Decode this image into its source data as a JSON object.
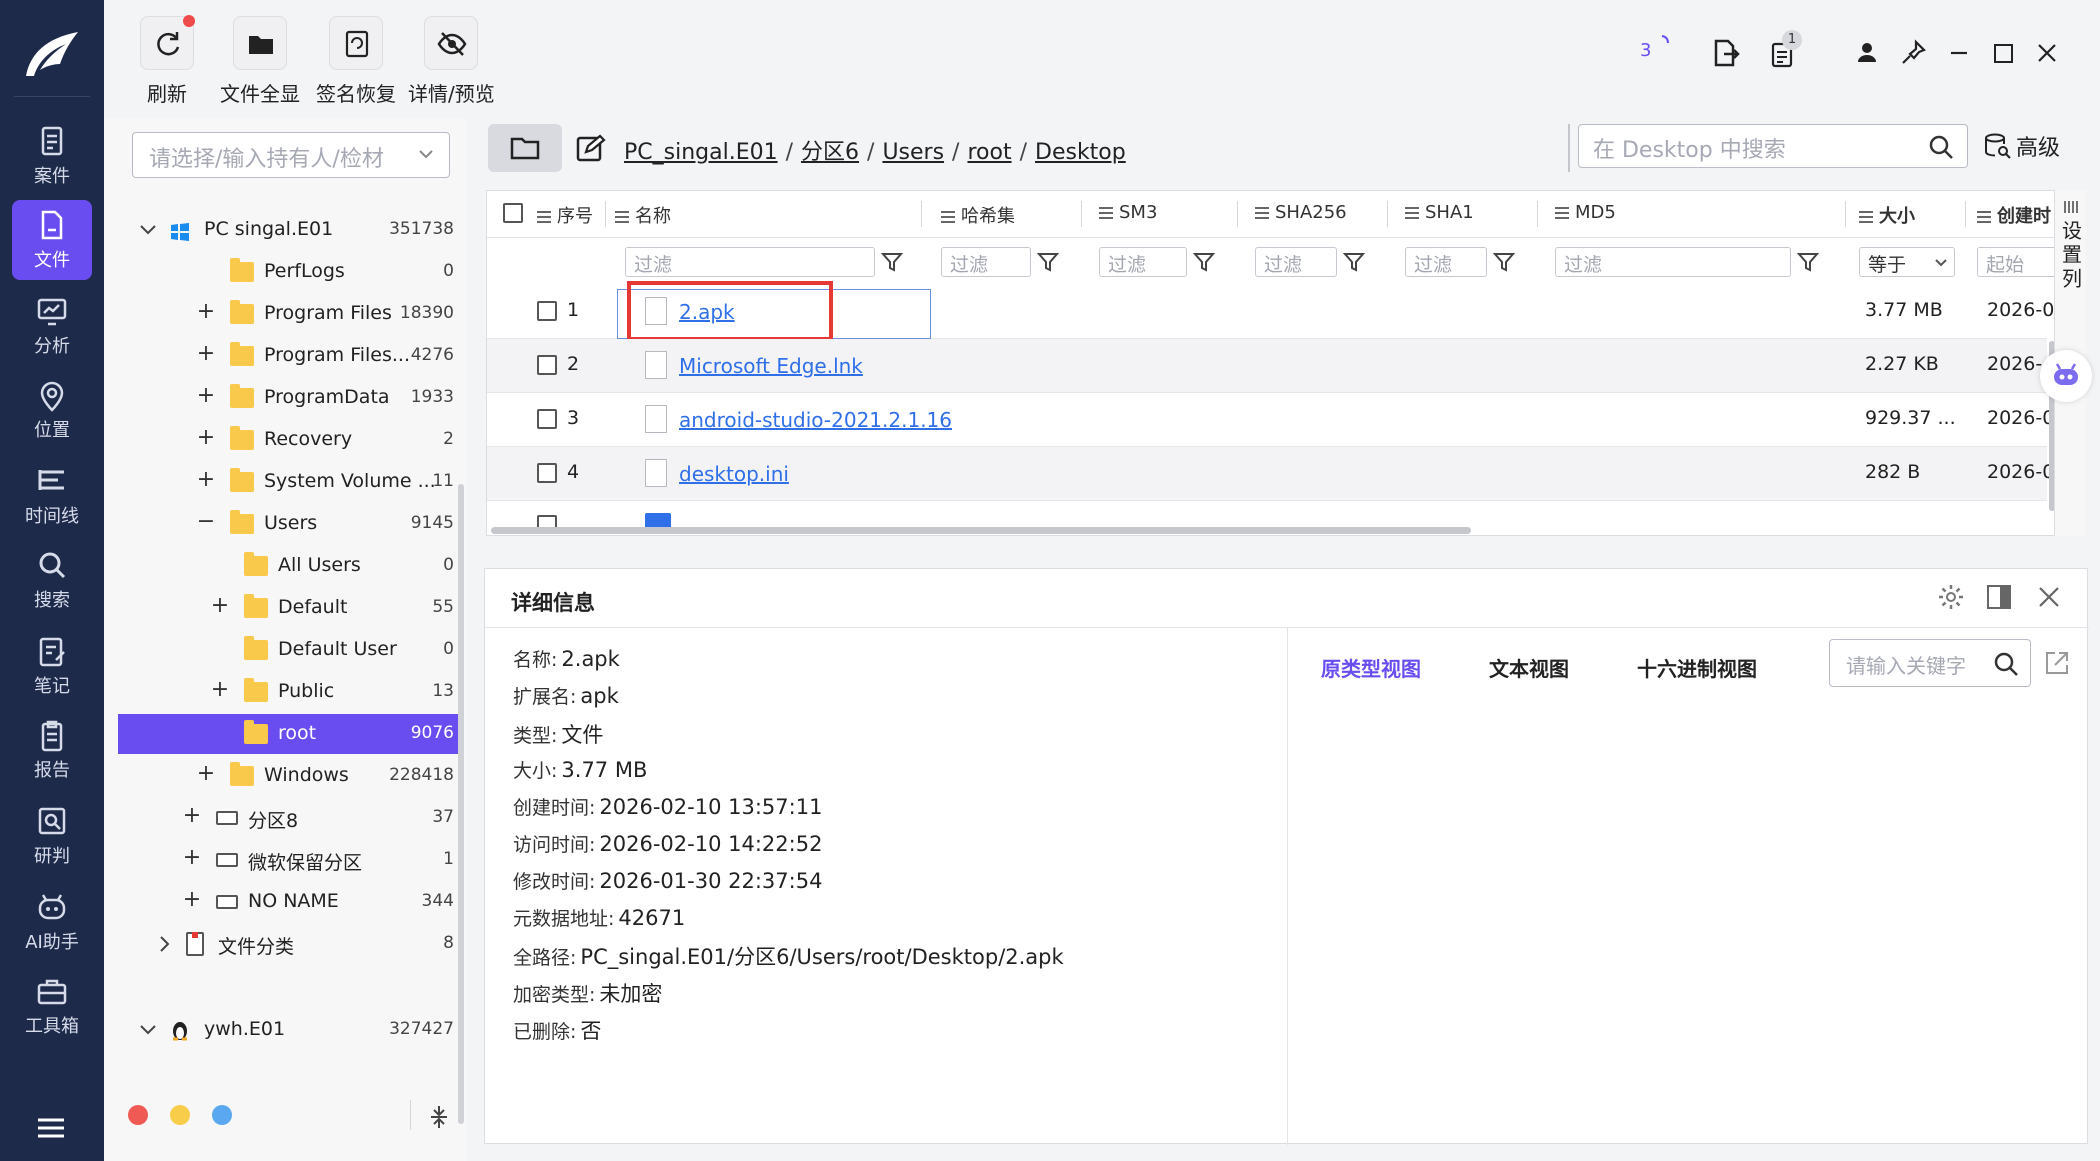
{
  "toolbar": {
    "refresh": "刷新",
    "show_all": "文件全显",
    "sig_restore": "签名恢复",
    "detail_preview": "详情/预览",
    "badge_count": "3",
    "tasks_badge": "1"
  },
  "rail": [
    {
      "label": "案件",
      "icon": "case-icon"
    },
    {
      "label": "文件",
      "icon": "file-icon"
    },
    {
      "label": "分析",
      "icon": "analysis-icon"
    },
    {
      "label": "位置",
      "icon": "location-icon"
    },
    {
      "label": "时间线",
      "icon": "timeline-icon"
    },
    {
      "label": "搜索",
      "icon": "search-icon"
    },
    {
      "label": "笔记",
      "icon": "note-icon"
    },
    {
      "label": "报告",
      "icon": "report-icon"
    },
    {
      "label": "研判",
      "icon": "judge-icon"
    },
    {
      "label": "AI助手",
      "icon": "robot-icon"
    },
    {
      "label": "工具箱",
      "icon": "toolbox-icon"
    }
  ],
  "tree": {
    "owner_placeholder": "请选择/输入持有人/检材",
    "items": [
      {
        "name": "PC singal.E01",
        "count": "351738"
      },
      {
        "name": "PerfLogs",
        "count": "0"
      },
      {
        "name": "Program Files",
        "count": "18390"
      },
      {
        "name": "Program Files...",
        "count": "4276"
      },
      {
        "name": "ProgramData",
        "count": "1933"
      },
      {
        "name": "Recovery",
        "count": "2"
      },
      {
        "name": "System Volume ...",
        "count": "11"
      },
      {
        "name": "Users",
        "count": "9145"
      },
      {
        "name": "All Users",
        "count": "0"
      },
      {
        "name": "Default",
        "count": "55"
      },
      {
        "name": "Default User",
        "count": "0"
      },
      {
        "name": "Public",
        "count": "13"
      },
      {
        "name": "root",
        "count": "9076"
      },
      {
        "name": "Windows",
        "count": "228418"
      },
      {
        "name": "分区8",
        "count": "37"
      },
      {
        "name": "微软保留分区",
        "count": "1"
      },
      {
        "name": "NO NAME",
        "count": "344"
      },
      {
        "name": "文件分类",
        "count": "8"
      },
      {
        "name": "ywh.E01",
        "count": "327427"
      }
    ]
  },
  "path": {
    "crumbs": [
      "PC_singal.E01",
      "分区6",
      "Users",
      "root",
      "Desktop"
    ],
    "search_placeholder": "在 Desktop 中搜索",
    "advanced": "高级"
  },
  "grid": {
    "headers": {
      "seq": "序号",
      "name": "名称",
      "hashset": "哈希集",
      "sm3": "SM3",
      "sha256": "SHA256",
      "sha1": "SHA1",
      "md5": "MD5",
      "size": "大小",
      "created": "创建时"
    },
    "filter_placeholder": "过滤",
    "size_filter": "等于",
    "created_filter": "起始",
    "set_columns": "设置列",
    "rows": [
      {
        "no": "1",
        "name": "2.apk",
        "size": "3.77 MB",
        "date": "2026-0"
      },
      {
        "no": "2",
        "name": "Microsoft Edge.lnk",
        "size": "2.27 KB",
        "date": "2026-"
      },
      {
        "no": "3",
        "name": "android-studio-2021.2.1.16",
        "size": "929.37 ...",
        "date": "2026-0"
      },
      {
        "no": "4",
        "name": "desktop.ini",
        "size": "282 B",
        "date": "2026-0"
      }
    ]
  },
  "details": {
    "title": "详细信息",
    "fields": [
      {
        "k": "名称:",
        "v": "2.apk"
      },
      {
        "k": "扩展名:",
        "v": "apk"
      },
      {
        "k": "类型:",
        "v": "文件"
      },
      {
        "k": "大小:",
        "v": "3.77 MB"
      },
      {
        "k": "创建时间:",
        "v": "2026-02-10 13:57:11"
      },
      {
        "k": "访问时间:",
        "v": "2026-02-10 14:22:52"
      },
      {
        "k": "修改时间:",
        "v": "2026-01-30 22:37:54"
      },
      {
        "k": "元数据地址:",
        "v": "42671"
      },
      {
        "k": "全路径:",
        "v": "PC_singal.E01/分区6/Users/root/Desktop/2.apk"
      },
      {
        "k": "加密类型:",
        "v": "未加密"
      },
      {
        "k": "已删除:",
        "v": "否"
      }
    ],
    "tabs": [
      "原类型视图",
      "文本视图",
      "十六进制视图"
    ],
    "keyword_placeholder": "请输入关键字"
  },
  "colors": {
    "accent": "#6a4df0",
    "rail": "#1e2a4a",
    "link": "#2f6fe8",
    "highlight": "#e53935"
  }
}
